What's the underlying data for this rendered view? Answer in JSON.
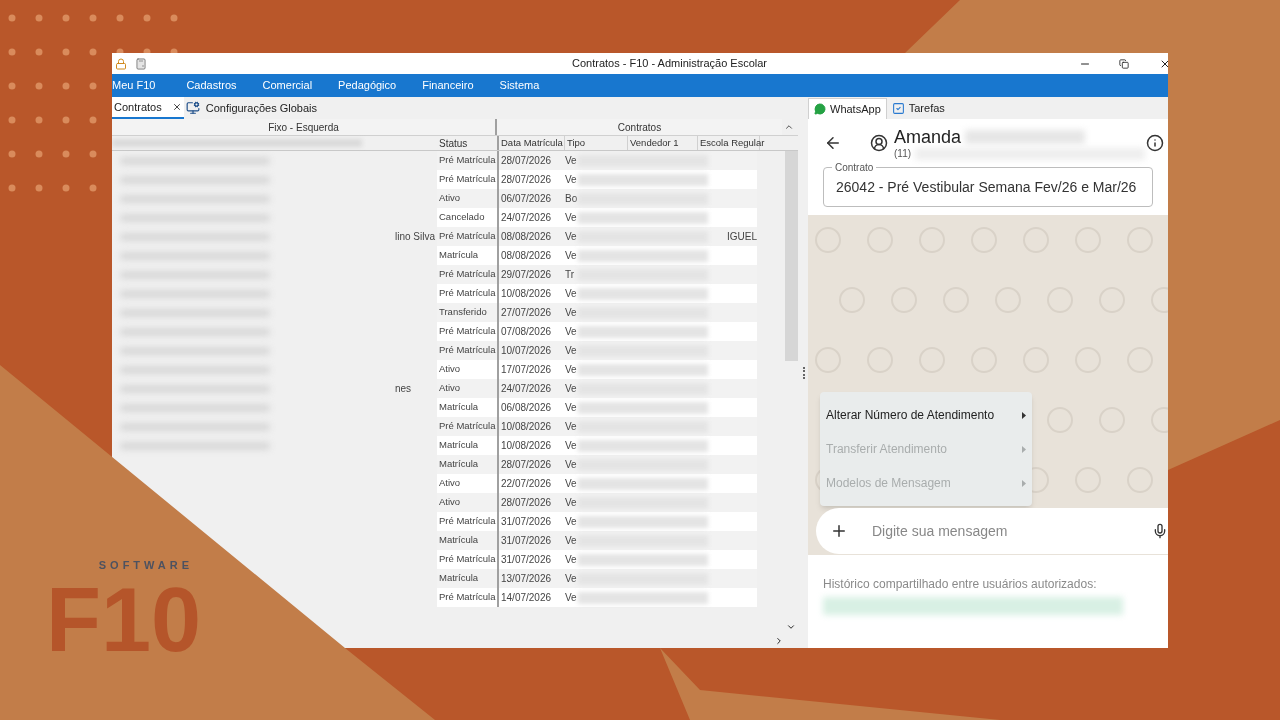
{
  "brand": {
    "software": "SOFTWARE",
    "mark": "F10"
  },
  "window": {
    "title": "Contratos - F10 - Administração Escolar"
  },
  "menu": [
    "Meu F10",
    "Cadastros",
    "Comercial",
    "Pedagógico",
    "Financeiro",
    "Sistema"
  ],
  "tabs": [
    {
      "label": "Contratos",
      "selected": true,
      "closable": true
    },
    {
      "label": "Configurações Globais",
      "selected": false,
      "closable": false
    }
  ],
  "grid": {
    "groups": [
      "Fixo - Esquerda",
      "Contratos"
    ],
    "columns": [
      "Status",
      "Data Matrícula",
      "Tipo",
      "Vendedor 1",
      "Escola Regular"
    ],
    "rows": [
      {
        "status": "Pré Matrícula",
        "date": "28/07/2026",
        "tipo": "Ve",
        "selected": false
      },
      {
        "status": "Pré Matrícula",
        "date": "28/07/2026",
        "tipo": "Ve",
        "selected": false
      },
      {
        "status": "Ativo",
        "date": "06/07/2026",
        "tipo": "Bo",
        "selected": false
      },
      {
        "status": "Cancelado",
        "date": "24/07/2026",
        "tipo": "Ve",
        "selected": false
      },
      {
        "status": "Pré Matrícula",
        "date": "08/08/2026",
        "tipo": "Ve",
        "selected": false,
        "title_fragment": "lino Silva",
        "school_fragment": "IGUEL"
      },
      {
        "status": "Matrícula",
        "date": "08/08/2026",
        "tipo": "Ve",
        "selected": false
      },
      {
        "status": "Pré Matrícula",
        "date": "29/07/2026",
        "tipo": "Tr",
        "selected": false
      },
      {
        "status": "Pré Matrícula",
        "date": "10/08/2026",
        "tipo": "Ve",
        "selected": false
      },
      {
        "status": "Transferido",
        "date": "27/07/2026",
        "tipo": "Ve",
        "selected": false
      },
      {
        "status": "Pré Matrícula",
        "date": "07/08/2026",
        "tipo": "Ve",
        "selected": false
      },
      {
        "status": "Pré Matrícula",
        "date": "10/07/2026",
        "tipo": "Ve",
        "selected": false
      },
      {
        "status": "Ativo",
        "date": "17/07/2026",
        "tipo": "Ve",
        "selected": false
      },
      {
        "status": "Ativo",
        "date": "24/07/2026",
        "tipo": "Ve",
        "selected": false,
        "title_fragment": "nes"
      },
      {
        "status": "Matrícula",
        "date": "06/08/2026",
        "tipo": "Ve",
        "selected": false
      },
      {
        "status": "Pré Matrícula",
        "date": "10/08/2026",
        "tipo": "Ve",
        "selected": false
      },
      {
        "status": "Matrícula",
        "date": "10/08/2026",
        "tipo": "Ve",
        "selected": false
      },
      {
        "status": "Matrícula",
        "date": "28/07/2026",
        "tipo": "Ve",
        "selected": false
      },
      {
        "status": "Ativo",
        "date": "22/07/2026",
        "tipo": "Ve",
        "selected": false
      },
      {
        "status": "Ativo",
        "date": "28/07/2026",
        "tipo": "Ve",
        "selected": false
      },
      {
        "status": "Pré Matrícula",
        "date": "31/07/2026",
        "tipo": "Ve",
        "selected": false
      },
      {
        "status": "Matrícula",
        "date": "31/07/2026",
        "tipo": "Ve",
        "selected": false
      },
      {
        "status": "Pré Matrícula",
        "date": "31/07/2026",
        "tipo": "Ve",
        "selected": false
      },
      {
        "status": "Matrícula",
        "date": "13/07/2026",
        "tipo": "Ve",
        "selected": false
      },
      {
        "status": "Pré Matrícula",
        "date": "14/07/2026",
        "tipo": "Ve",
        "selected": false
      }
    ]
  },
  "side_tabs": [
    {
      "label": "WhatsApp",
      "selected": true
    },
    {
      "label": "Tarefas",
      "selected": false
    }
  ],
  "chat": {
    "contact_name": "Amanda",
    "contact_phone": "(11)",
    "contract": {
      "label": "Contrato",
      "value": "26042 - Pré Vestibular Semana Fev/26 e Mar/26"
    },
    "menu": [
      {
        "label": "Alterar Número de Atendimento",
        "disabled": false
      },
      {
        "label": "Transferir Atendimento",
        "disabled": true
      },
      {
        "label": "Modelos de Mensagem",
        "disabled": true
      }
    ],
    "message": {
      "placeholder": "Digite sua mensagem"
    },
    "history_label": "Histórico compartilhado entre usuários autorizados:"
  }
}
